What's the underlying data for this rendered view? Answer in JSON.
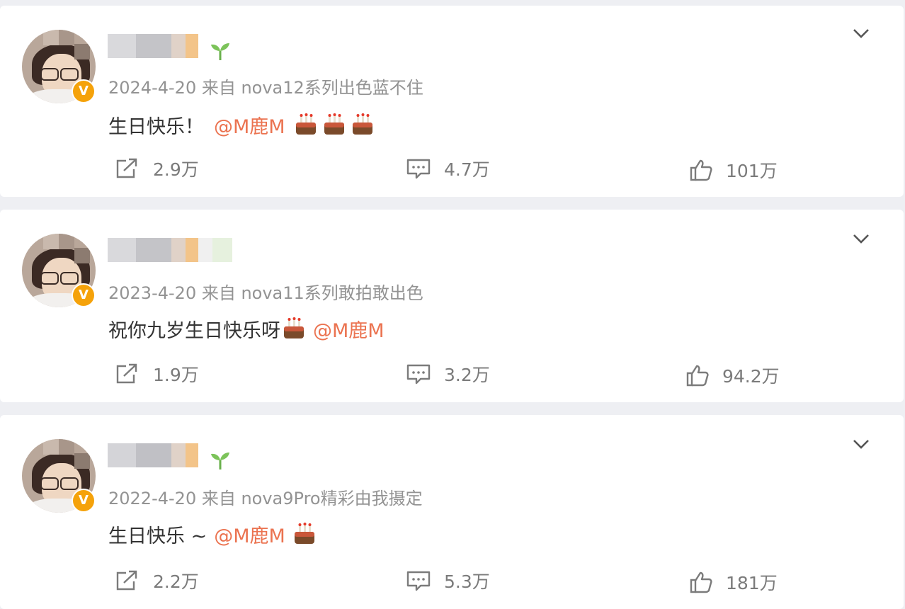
{
  "posts": [
    {
      "meta": "2024-4-20 来自 nova12系列出色蓝不住",
      "content_text": "生日快乐！",
      "mention": "@M鹿M",
      "cakes": 3,
      "has_sprout": true,
      "reposts": "2.9万",
      "comments": "4.7万",
      "likes": "101万"
    },
    {
      "meta": "2023-4-20 来自 nova11系列敢拍敢出色",
      "content_text": "祝你九岁生日快乐呀",
      "mention": "@M鹿M",
      "cakes": 1,
      "cake_before_mention": true,
      "has_sprout": false,
      "reposts": "1.9万",
      "comments": "3.2万",
      "likes": "94.2万"
    },
    {
      "meta": "2022-4-20 来自 nova9Pro精彩由我摄定",
      "content_text": "生日快乐 ~",
      "mention": "@M鹿M",
      "cakes": 1,
      "has_sprout": true,
      "reposts": "2.2万",
      "comments": "5.3万",
      "likes": "181万"
    }
  ],
  "icons": {
    "repost": "repost-icon",
    "comment": "comment-icon",
    "like": "thumbs-up-icon",
    "more": "chevron-down-icon",
    "verified": "verified-v-badge-icon",
    "sprout": "sprout-icon",
    "cake": "birthday-cake-emoji"
  },
  "colors": {
    "mention": "#eb7350",
    "meta": "#939393",
    "badge": "#f5a20a",
    "page_bg": "#eeeff3"
  },
  "badge_letter": "V"
}
